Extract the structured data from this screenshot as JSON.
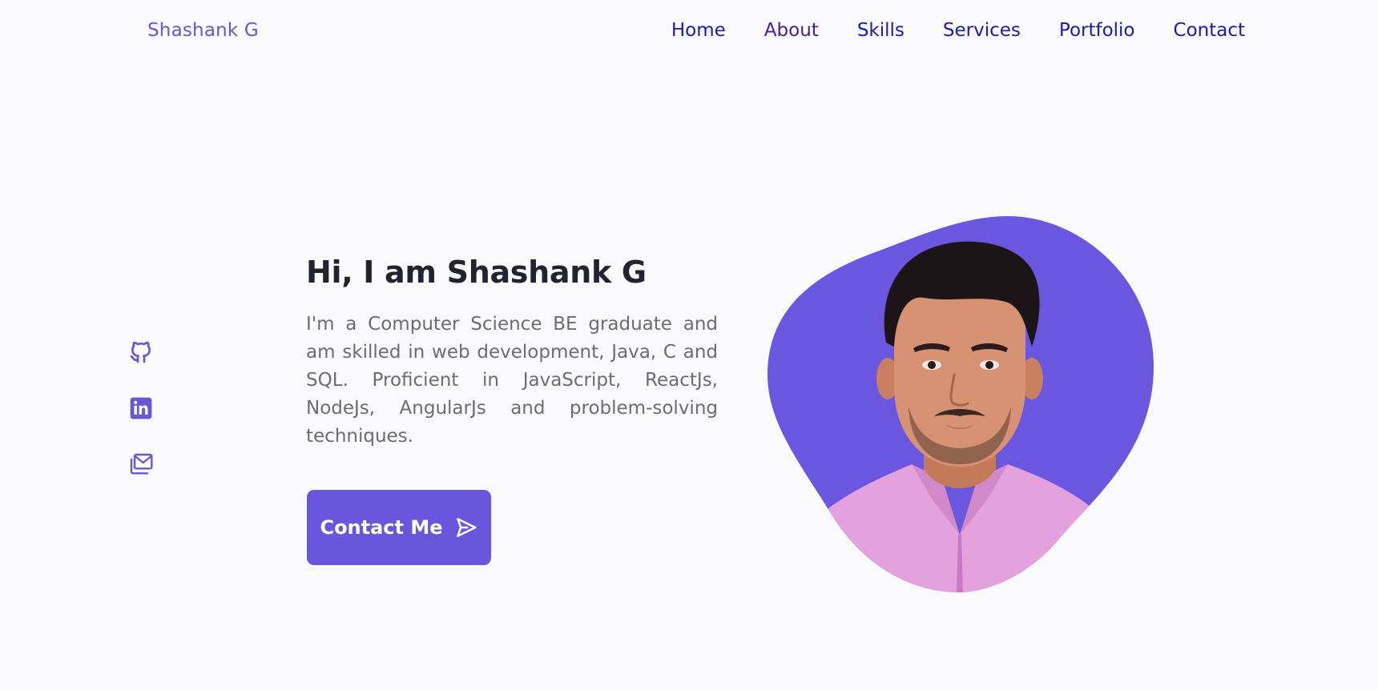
{
  "header": {
    "logo": "Shashank G",
    "nav": [
      {
        "label": "Home"
      },
      {
        "label": "About"
      },
      {
        "label": "Skills"
      },
      {
        "label": "Services"
      },
      {
        "label": "Portfolio"
      },
      {
        "label": "Contact"
      }
    ]
  },
  "social": {
    "icons": [
      "github-icon",
      "linkedin-icon",
      "email-icon"
    ]
  },
  "hero": {
    "title": "Hi, I am Shashank G",
    "description": "I'm a Computer Science BE graduate and am skilled in web development, Java, C and SQL. Proficient in JavaScript, ReactJs, NodeJs, AngularJs and problem-solving techniques.",
    "button_label": "Contact Me",
    "button_icon": "send-icon"
  },
  "colors": {
    "accent": "#6a55dd",
    "nav_link": "#1a1ab0",
    "nav_link_visited": "#4b1a8c",
    "background": "#fafafc"
  }
}
